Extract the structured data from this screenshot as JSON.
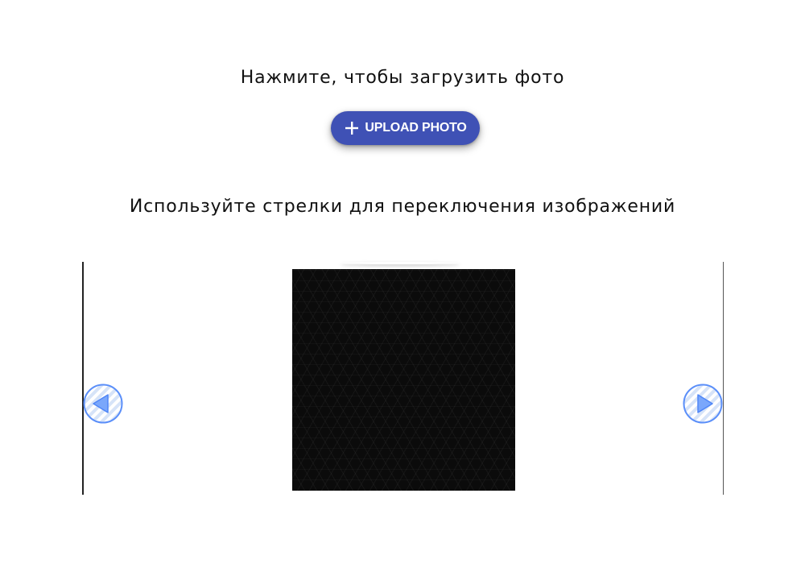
{
  "upload": {
    "hint": "Нажмите, чтобы загрузить фото",
    "button_label": "UPLOAD PHOTO",
    "button_icon": "plus-icon",
    "button_color": "#3f51b5"
  },
  "gallery": {
    "hint": "Используйте стрелки для переключения изображений",
    "prev_icon": "arrow-left-icon",
    "next_icon": "arrow-right-icon",
    "arrow_color": "#5b8ff9"
  }
}
